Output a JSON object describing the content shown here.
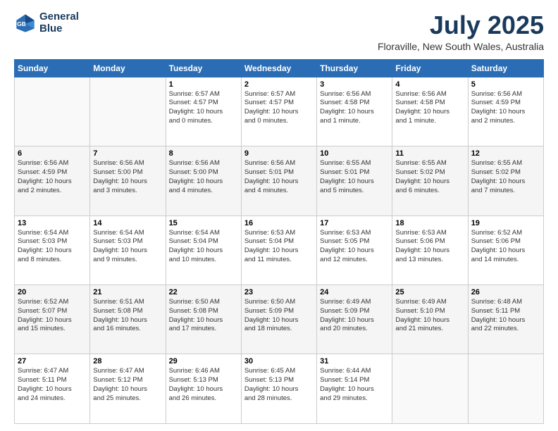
{
  "header": {
    "logo_line1": "General",
    "logo_line2": "Blue",
    "month": "July 2025",
    "location": "Floraville, New South Wales, Australia"
  },
  "weekdays": [
    "Sunday",
    "Monday",
    "Tuesday",
    "Wednesday",
    "Thursday",
    "Friday",
    "Saturday"
  ],
  "weeks": [
    [
      {
        "day": "",
        "info": ""
      },
      {
        "day": "",
        "info": ""
      },
      {
        "day": "1",
        "info": "Sunrise: 6:57 AM\nSunset: 4:57 PM\nDaylight: 10 hours\nand 0 minutes."
      },
      {
        "day": "2",
        "info": "Sunrise: 6:57 AM\nSunset: 4:57 PM\nDaylight: 10 hours\nand 0 minutes."
      },
      {
        "day": "3",
        "info": "Sunrise: 6:56 AM\nSunset: 4:58 PM\nDaylight: 10 hours\nand 1 minute."
      },
      {
        "day": "4",
        "info": "Sunrise: 6:56 AM\nSunset: 4:58 PM\nDaylight: 10 hours\nand 1 minute."
      },
      {
        "day": "5",
        "info": "Sunrise: 6:56 AM\nSunset: 4:59 PM\nDaylight: 10 hours\nand 2 minutes."
      }
    ],
    [
      {
        "day": "6",
        "info": "Sunrise: 6:56 AM\nSunset: 4:59 PM\nDaylight: 10 hours\nand 2 minutes."
      },
      {
        "day": "7",
        "info": "Sunrise: 6:56 AM\nSunset: 5:00 PM\nDaylight: 10 hours\nand 3 minutes."
      },
      {
        "day": "8",
        "info": "Sunrise: 6:56 AM\nSunset: 5:00 PM\nDaylight: 10 hours\nand 4 minutes."
      },
      {
        "day": "9",
        "info": "Sunrise: 6:56 AM\nSunset: 5:01 PM\nDaylight: 10 hours\nand 4 minutes."
      },
      {
        "day": "10",
        "info": "Sunrise: 6:55 AM\nSunset: 5:01 PM\nDaylight: 10 hours\nand 5 minutes."
      },
      {
        "day": "11",
        "info": "Sunrise: 6:55 AM\nSunset: 5:02 PM\nDaylight: 10 hours\nand 6 minutes."
      },
      {
        "day": "12",
        "info": "Sunrise: 6:55 AM\nSunset: 5:02 PM\nDaylight: 10 hours\nand 7 minutes."
      }
    ],
    [
      {
        "day": "13",
        "info": "Sunrise: 6:54 AM\nSunset: 5:03 PM\nDaylight: 10 hours\nand 8 minutes."
      },
      {
        "day": "14",
        "info": "Sunrise: 6:54 AM\nSunset: 5:03 PM\nDaylight: 10 hours\nand 9 minutes."
      },
      {
        "day": "15",
        "info": "Sunrise: 6:54 AM\nSunset: 5:04 PM\nDaylight: 10 hours\nand 10 minutes."
      },
      {
        "day": "16",
        "info": "Sunrise: 6:53 AM\nSunset: 5:04 PM\nDaylight: 10 hours\nand 11 minutes."
      },
      {
        "day": "17",
        "info": "Sunrise: 6:53 AM\nSunset: 5:05 PM\nDaylight: 10 hours\nand 12 minutes."
      },
      {
        "day": "18",
        "info": "Sunrise: 6:53 AM\nSunset: 5:06 PM\nDaylight: 10 hours\nand 13 minutes."
      },
      {
        "day": "19",
        "info": "Sunrise: 6:52 AM\nSunset: 5:06 PM\nDaylight: 10 hours\nand 14 minutes."
      }
    ],
    [
      {
        "day": "20",
        "info": "Sunrise: 6:52 AM\nSunset: 5:07 PM\nDaylight: 10 hours\nand 15 minutes."
      },
      {
        "day": "21",
        "info": "Sunrise: 6:51 AM\nSunset: 5:08 PM\nDaylight: 10 hours\nand 16 minutes."
      },
      {
        "day": "22",
        "info": "Sunrise: 6:50 AM\nSunset: 5:08 PM\nDaylight: 10 hours\nand 17 minutes."
      },
      {
        "day": "23",
        "info": "Sunrise: 6:50 AM\nSunset: 5:09 PM\nDaylight: 10 hours\nand 18 minutes."
      },
      {
        "day": "24",
        "info": "Sunrise: 6:49 AM\nSunset: 5:09 PM\nDaylight: 10 hours\nand 20 minutes."
      },
      {
        "day": "25",
        "info": "Sunrise: 6:49 AM\nSunset: 5:10 PM\nDaylight: 10 hours\nand 21 minutes."
      },
      {
        "day": "26",
        "info": "Sunrise: 6:48 AM\nSunset: 5:11 PM\nDaylight: 10 hours\nand 22 minutes."
      }
    ],
    [
      {
        "day": "27",
        "info": "Sunrise: 6:47 AM\nSunset: 5:11 PM\nDaylight: 10 hours\nand 24 minutes."
      },
      {
        "day": "28",
        "info": "Sunrise: 6:47 AM\nSunset: 5:12 PM\nDaylight: 10 hours\nand 25 minutes."
      },
      {
        "day": "29",
        "info": "Sunrise: 6:46 AM\nSunset: 5:13 PM\nDaylight: 10 hours\nand 26 minutes."
      },
      {
        "day": "30",
        "info": "Sunrise: 6:45 AM\nSunset: 5:13 PM\nDaylight: 10 hours\nand 28 minutes."
      },
      {
        "day": "31",
        "info": "Sunrise: 6:44 AM\nSunset: 5:14 PM\nDaylight: 10 hours\nand 29 minutes."
      },
      {
        "day": "",
        "info": ""
      },
      {
        "day": "",
        "info": ""
      }
    ]
  ]
}
